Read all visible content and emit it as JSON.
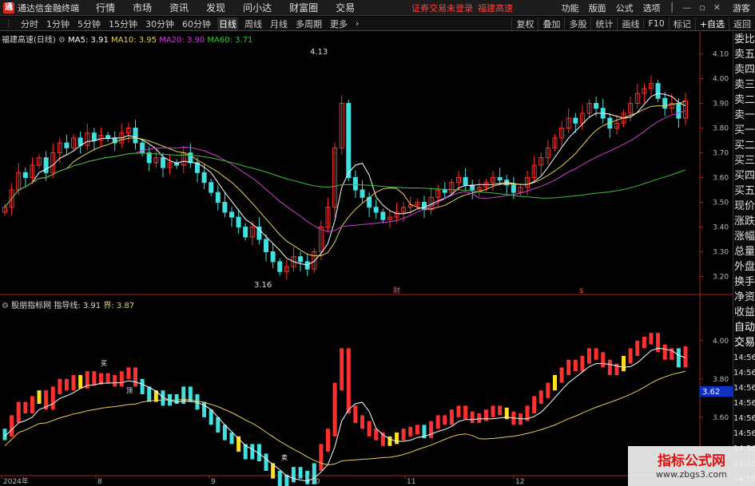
{
  "titlebar": {
    "app_name": "通达信金融终端",
    "menus": [
      "行情",
      "市场",
      "资讯",
      "发现",
      "问小达",
      "财富圈",
      "交易"
    ],
    "notice": "证券交易未登录",
    "stock_name": "福建高速",
    "right_menus": [
      "功能",
      "版面",
      "公式",
      "选项"
    ],
    "guest": "游客"
  },
  "toolbar": {
    "periods": [
      "分时",
      "1分钟",
      "5分钟",
      "15分钟",
      "30分钟",
      "60分钟",
      "日线",
      "周线",
      "月线",
      "多周期",
      "更多"
    ],
    "active_period": "日线",
    "right_buttons": [
      "复权",
      "叠加",
      "多股",
      "统计",
      "画线",
      "F10",
      "标记",
      "+自选",
      "返回"
    ]
  },
  "main_chart": {
    "title": "福建高速(日线)",
    "ma5_label": "MA5: 3.91",
    "ma10_label": "MA10: 3.95",
    "ma20_label": "MA20: 3.90",
    "ma60_label": "MA60: 3.71",
    "colors": {
      "ma5": "#ffffff",
      "ma10": "#e8d060",
      "ma20": "#d040d0",
      "ma60": "#40c040",
      "up": "#ff3030",
      "down": "#40e0e0"
    },
    "high_label": "4.13",
    "low_label": "3.16",
    "event_marks": [
      "财",
      "$"
    ]
  },
  "indicator": {
    "title": "股朋指标网",
    "guide_label": "指导线: 3.91",
    "bound_label": "界: 3.87",
    "current_value": "3.62",
    "signal_marks": [
      "买",
      "卖",
      "顶"
    ]
  },
  "right_strip": {
    "items": [
      "委比",
      "卖五",
      "卖四",
      "卖三",
      "卖二",
      "卖一",
      "买一",
      "买二",
      "买三",
      "买四",
      "买五",
      "现价",
      "涨跌",
      "涨幅",
      "总量",
      "外盘",
      "换手",
      "净资",
      "收益"
    ],
    "trade_items": [
      "自动",
      "交易"
    ],
    "times": [
      "14:56",
      "14:56",
      "14:56",
      "14:56",
      "14:56",
      "14:56",
      "14:56",
      "14:56",
      "14:56"
    ]
  },
  "watermark": {
    "line1": "指标公式网",
    "line2": "www.zbgs3.com"
  },
  "chart_data": {
    "type": "candlestick",
    "main_y_ticks": [
      "4.10",
      "4.00",
      "3.90",
      "3.80",
      "3.70",
      "3.60",
      "3.50",
      "3.40",
      "3.30",
      "3.20"
    ],
    "ind_y_ticks": [
      "4.00",
      "3.80",
      "3.60",
      "3.40"
    ],
    "x_ticks": [
      "2024年",
      "8",
      "9",
      "10",
      "11",
      "12"
    ],
    "ylim_main": [
      3.15,
      4.15
    ],
    "ylim_ind": [
      3.32,
      4.12
    ],
    "close": [
      3.48,
      3.55,
      3.62,
      3.6,
      3.65,
      3.68,
      3.62,
      3.7,
      3.74,
      3.72,
      3.76,
      3.73,
      3.78,
      3.75,
      3.77,
      3.76,
      3.74,
      3.78,
      3.8,
      3.74,
      3.7,
      3.66,
      3.68,
      3.64,
      3.66,
      3.65,
      3.7,
      3.66,
      3.62,
      3.58,
      3.54,
      3.5,
      3.46,
      3.44,
      3.4,
      3.36,
      3.4,
      3.35,
      3.3,
      3.26,
      3.22,
      3.24,
      3.28,
      3.26,
      3.23,
      3.3,
      3.4,
      3.48,
      3.72,
      3.9,
      3.6,
      3.55,
      3.52,
      3.48,
      3.46,
      3.43,
      3.44,
      3.46,
      3.48,
      3.49,
      3.5,
      3.47,
      3.52,
      3.55,
      3.54,
      3.58,
      3.6,
      3.57,
      3.55,
      3.56,
      3.58,
      3.6,
      3.59,
      3.57,
      3.54,
      3.56,
      3.6,
      3.65,
      3.68,
      3.72,
      3.76,
      3.8,
      3.84,
      3.82,
      3.86,
      3.9,
      3.88,
      3.84,
      3.8,
      3.82,
      3.86,
      3.9,
      3.94,
      3.96,
      3.98,
      3.92,
      3.88,
      3.9,
      3.84,
      3.91
    ]
  }
}
